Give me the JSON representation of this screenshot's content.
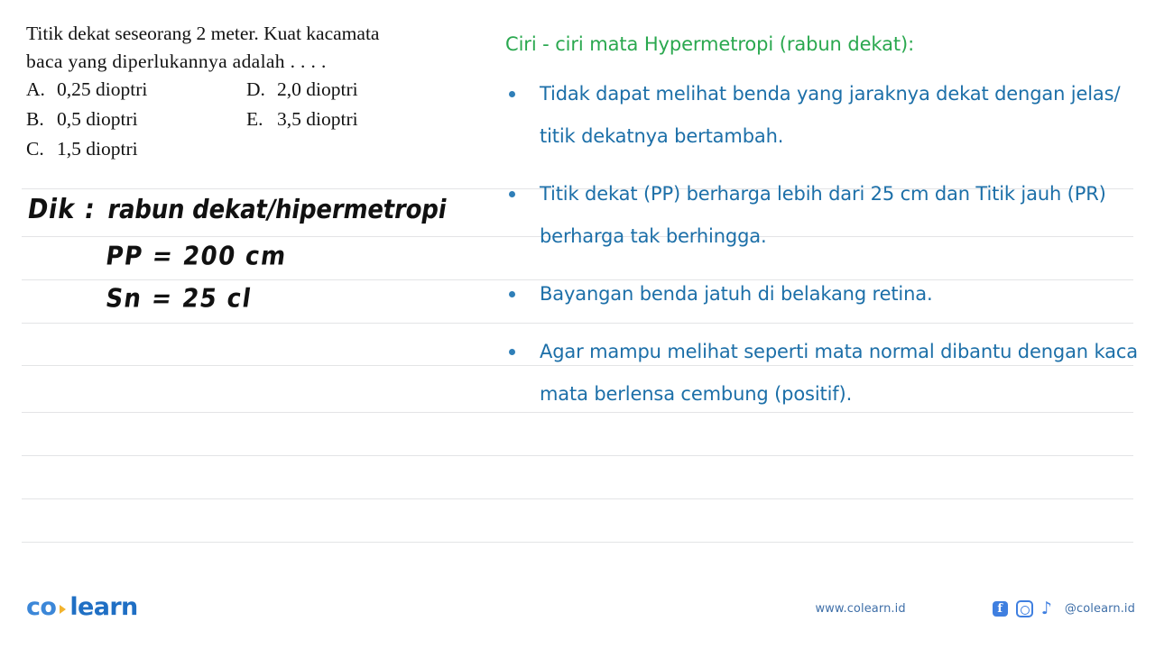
{
  "question": {
    "prompt_lines": [
      "Titik dekat seseorang 2 meter. Kuat kacamata",
      "baca yang diperlukannya adalah . . . ."
    ],
    "options": [
      {
        "key": "A.",
        "value": "0,25 dioptri"
      },
      {
        "key": "B.",
        "value": "0,5 dioptri"
      },
      {
        "key": "C.",
        "value": "1,5 dioptri"
      },
      {
        "key": "D.",
        "value": "2,0 dioptri"
      },
      {
        "key": "E.",
        "value": "3,5 dioptri"
      }
    ]
  },
  "handwriting": {
    "known_label": "Dik :",
    "known_value": "rabun dekat/hipermetropi",
    "line_pp": "PP = 200 cm",
    "line_sn": "Sn = 25 cl"
  },
  "explanation": {
    "heading": "Ciri - ciri mata Hypermetropi (rabun dekat):",
    "bullets": [
      "Tidak dapat melihat benda yang jaraknya dekat dengan jelas/ titik dekatnya bertambah.",
      "Titik dekat (PP) berharga lebih dari 25 cm dan Titik jauh (PR) berharga tak berhingga.",
      "Bayangan benda jatuh di belakang retina.",
      "Agar mampu melihat seperti mata normal dibantu dengan kaca mata berlensa cembung (positif)."
    ]
  },
  "footer": {
    "logo_left": "co",
    "logo_right": "learn",
    "website": "www.colearn.id",
    "handle": "@colearn.id",
    "facebook_glyph": "f",
    "tiktok_glyph": "♪"
  },
  "colors": {
    "heading_green": "#2aa84f",
    "body_blue": "#1c6fa8",
    "rule_gray": "#e3e4e6",
    "logo_blue": "#2f7fd0",
    "logo_accent": "#f2b32e",
    "social_blue": "#3f7fe0"
  },
  "rule_positions": [
    209,
    262,
    310,
    358,
    405,
    457,
    505,
    553,
    601
  ]
}
